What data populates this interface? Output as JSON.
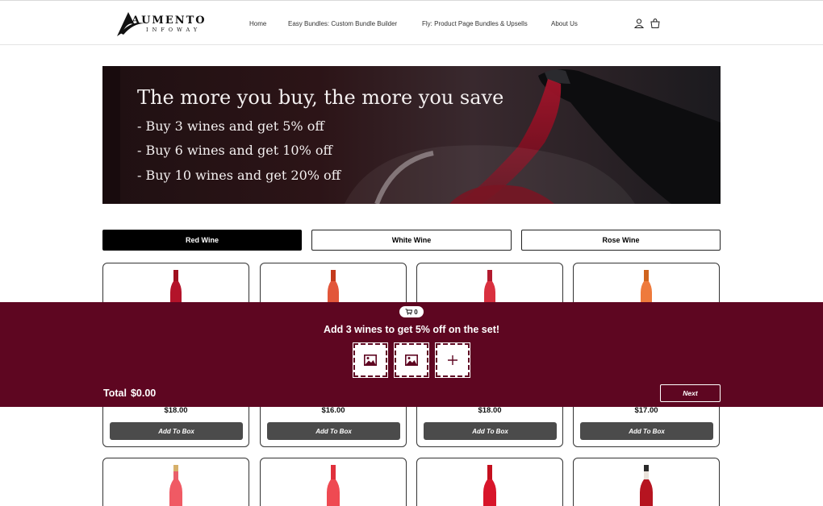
{
  "header": {
    "logo_text": "AUMENTO",
    "logo_sub": "INFOWAY",
    "nav": [
      "Home",
      "Easy Bundles: Custom Bundle Builder",
      "Fly: Product Page Bundles & Upsells",
      "About Us"
    ],
    "icons": [
      "account-icon",
      "cart-icon"
    ]
  },
  "hero": {
    "title": "The more you buy, the more you save",
    "bullets": [
      "- Buy 3 wines and get 5% off",
      "- Buy 6 wines and get 10% off",
      "- Buy 10 wines and get 20% off"
    ]
  },
  "tabs": [
    {
      "label": "Red Wine",
      "active": true
    },
    {
      "label": "White Wine",
      "active": false
    },
    {
      "label": "Rose Wine",
      "active": false
    }
  ],
  "products_row1": [
    {
      "price": "$18.00",
      "button": "Add To Box"
    },
    {
      "price": "$16.00",
      "button": "Add To Box"
    },
    {
      "price": "$18.00",
      "button": "Add To Box"
    },
    {
      "price": "$17.00",
      "button": "Add To Box"
    }
  ],
  "bundle": {
    "cart_count": "0",
    "message": "Add 3 wines to get 5% off on the set!",
    "slots": [
      "image-placeholder-icon",
      "image-placeholder-icon",
      "plus-icon"
    ],
    "total_label": "Total",
    "total_value": "$0.00",
    "next_label": "Next"
  },
  "colors": {
    "bundle_bg": "#5e0621",
    "active_tab": "#000000",
    "button_bg": "#4b4b4b"
  }
}
